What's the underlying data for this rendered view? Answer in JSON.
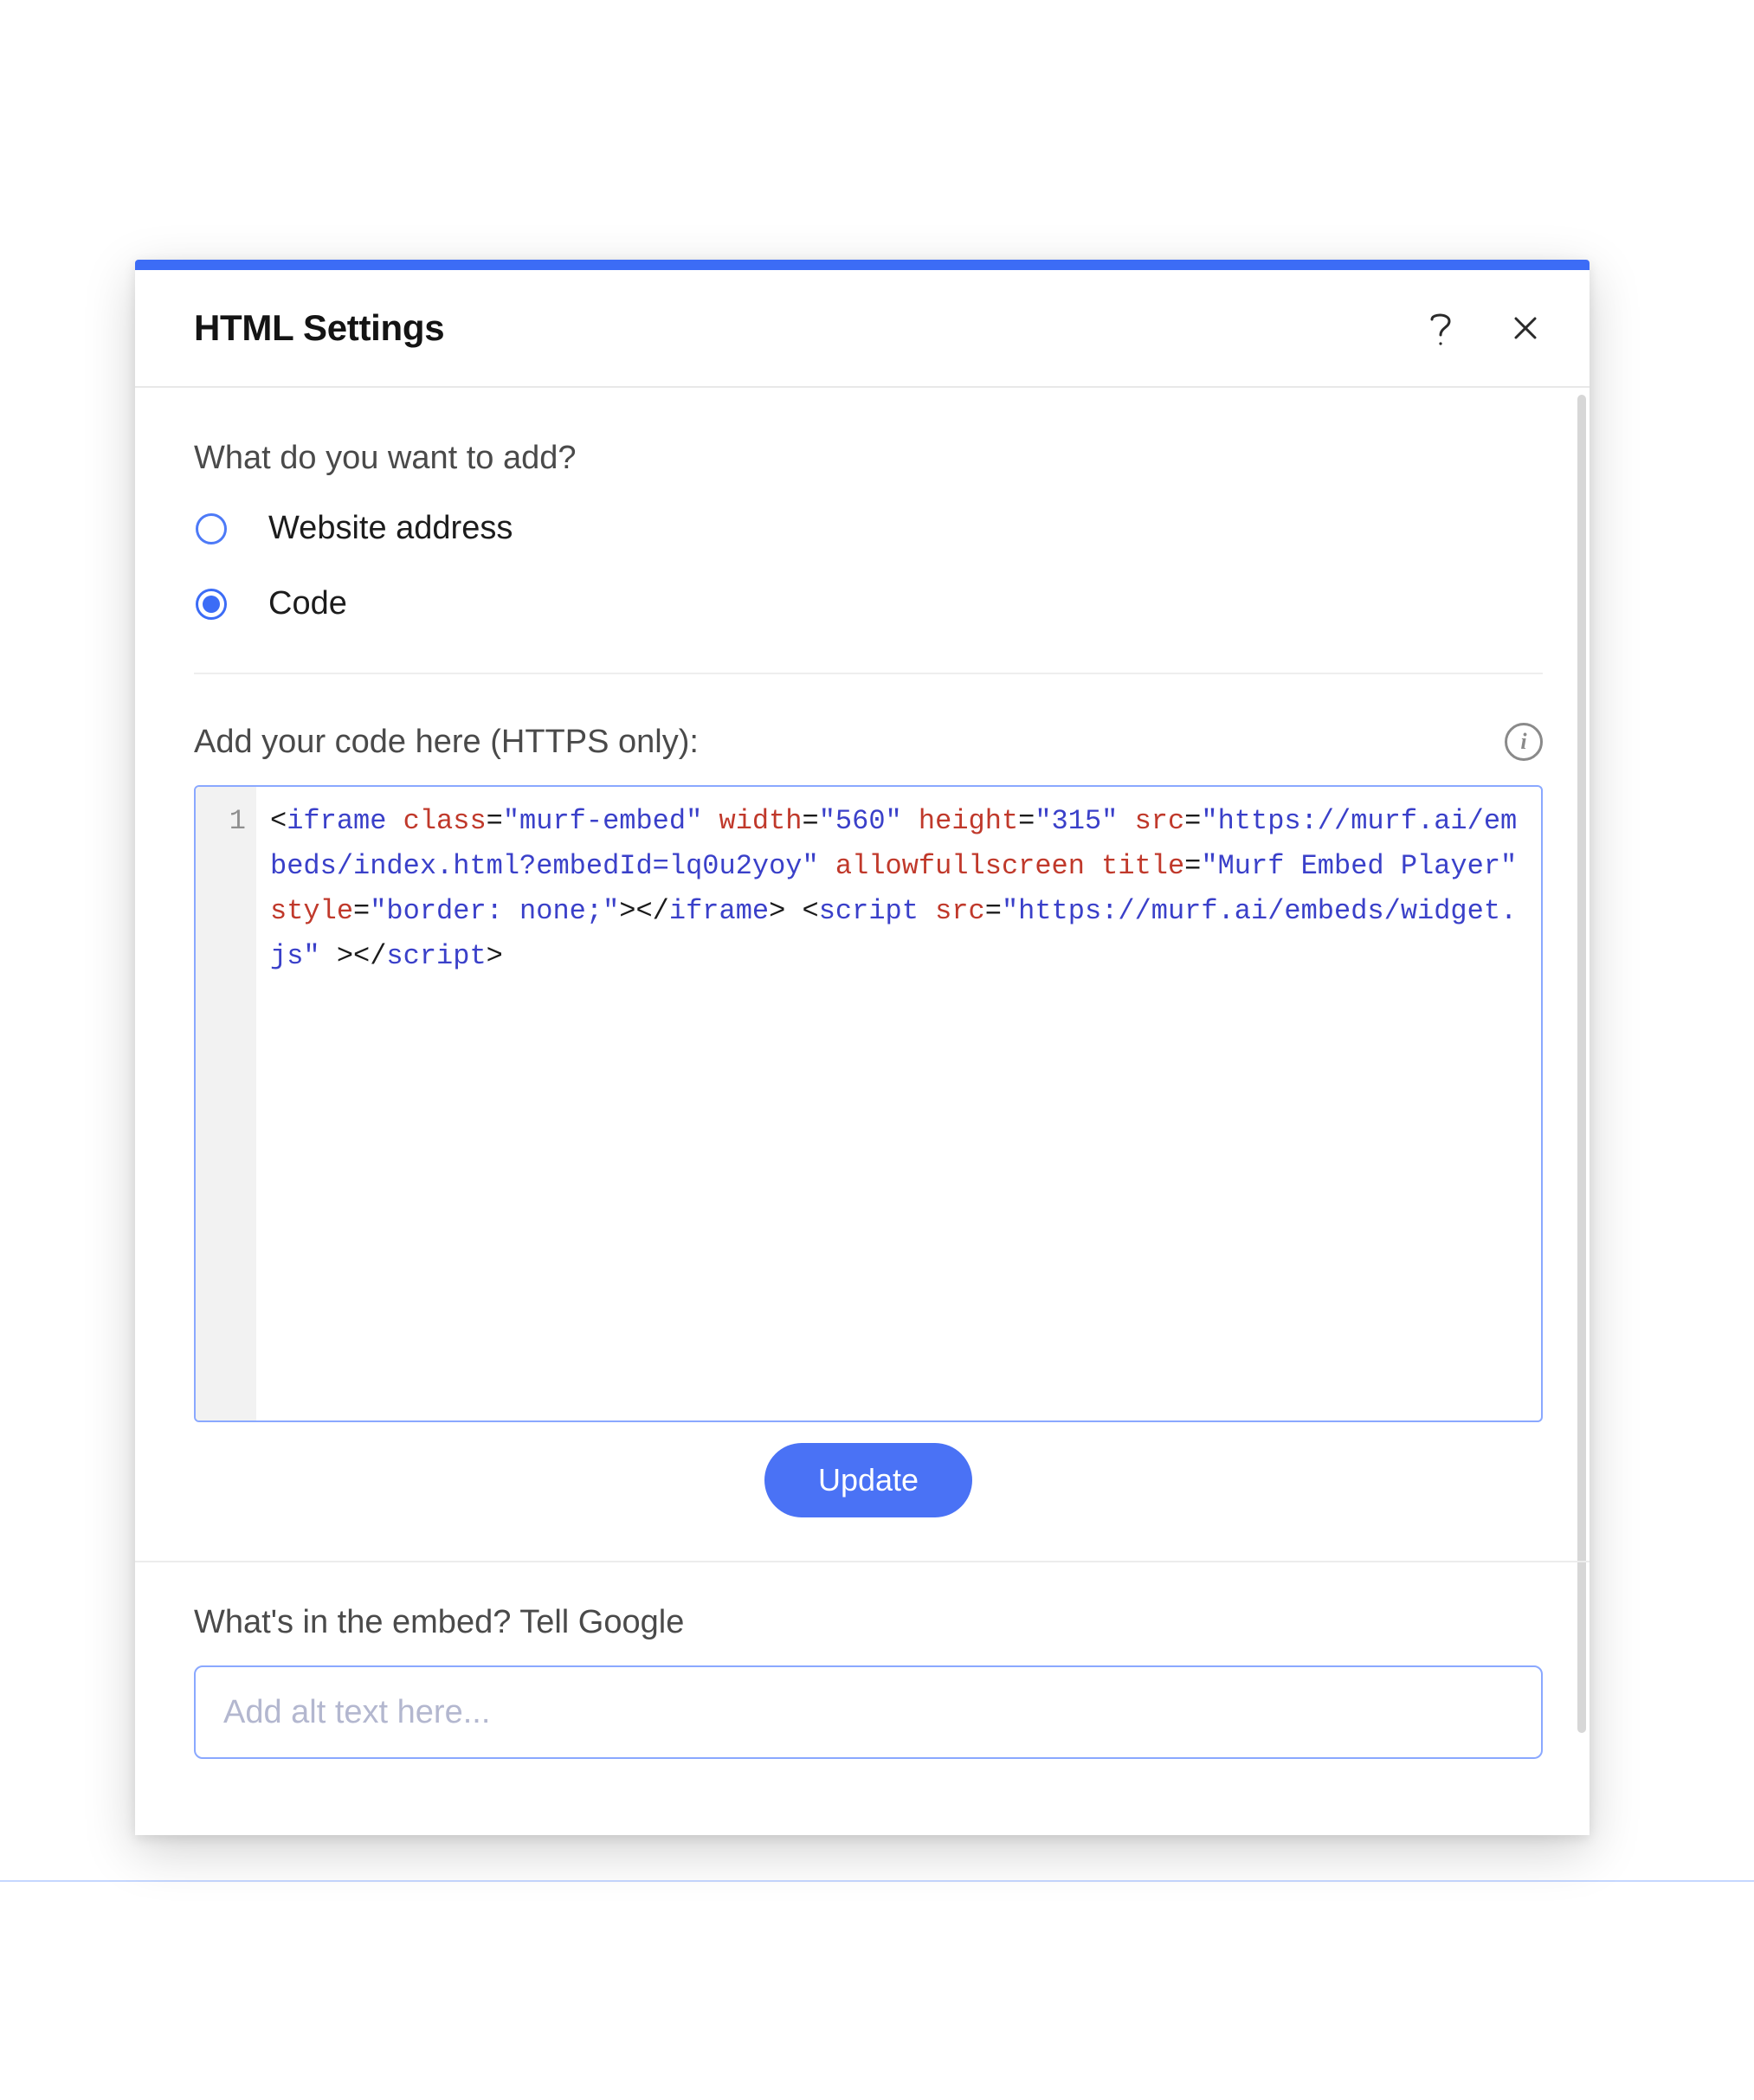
{
  "modal": {
    "title": "HTML Settings",
    "prompt": "What do you want to add?",
    "options": {
      "website": "Website address",
      "code": "Code"
    },
    "selected_option": "code",
    "code_section": {
      "label": "Add your code here (HTTPS only):",
      "line_number": "1",
      "tokens": [
        {
          "t": "punct",
          "v": "<"
        },
        {
          "t": "tag",
          "v": "iframe"
        },
        {
          "t": "punct",
          "v": " "
        },
        {
          "t": "attr",
          "v": "class"
        },
        {
          "t": "punct",
          "v": "="
        },
        {
          "t": "str",
          "v": "\"murf-embed\""
        },
        {
          "t": "punct",
          "v": " "
        },
        {
          "t": "attr",
          "v": "width"
        },
        {
          "t": "punct",
          "v": "="
        },
        {
          "t": "str",
          "v": "\"560\""
        },
        {
          "t": "punct",
          "v": " "
        },
        {
          "t": "attr",
          "v": "height"
        },
        {
          "t": "punct",
          "v": "="
        },
        {
          "t": "str",
          "v": "\"315\""
        },
        {
          "t": "punct",
          "v": " "
        },
        {
          "t": "attr",
          "v": "src"
        },
        {
          "t": "punct",
          "v": "="
        },
        {
          "t": "str",
          "v": "\"https://murf.ai/embeds/index.html?embedId=lq0u2yoy\""
        },
        {
          "t": "punct",
          "v": " "
        },
        {
          "t": "attr",
          "v": "allowfullscreen"
        },
        {
          "t": "punct",
          "v": " "
        },
        {
          "t": "attr",
          "v": "title"
        },
        {
          "t": "punct",
          "v": "="
        },
        {
          "t": "str",
          "v": "\"Murf Embed Player\""
        },
        {
          "t": "punct",
          "v": " "
        },
        {
          "t": "attr",
          "v": "style"
        },
        {
          "t": "punct",
          "v": "="
        },
        {
          "t": "str",
          "v": "\"border: none;\""
        },
        {
          "t": "punct",
          "v": ">"
        },
        {
          "t": "punct",
          "v": "</"
        },
        {
          "t": "tag",
          "v": "iframe"
        },
        {
          "t": "punct",
          "v": "> "
        },
        {
          "t": "punct",
          "v": "<"
        },
        {
          "t": "tag",
          "v": "script"
        },
        {
          "t": "punct",
          "v": " "
        },
        {
          "t": "attr",
          "v": "src"
        },
        {
          "t": "punct",
          "v": "="
        },
        {
          "t": "str",
          "v": "\"https://murf.ai/embeds/widget.js\""
        },
        {
          "t": "punct",
          "v": " >"
        },
        {
          "t": "punct",
          "v": "</"
        },
        {
          "t": "tag",
          "v": "script"
        },
        {
          "t": "punct",
          "v": ">"
        }
      ]
    },
    "update_button": "Update",
    "alt_section": {
      "label": "What's in the embed? Tell Google",
      "placeholder": "Add alt text here..."
    }
  }
}
